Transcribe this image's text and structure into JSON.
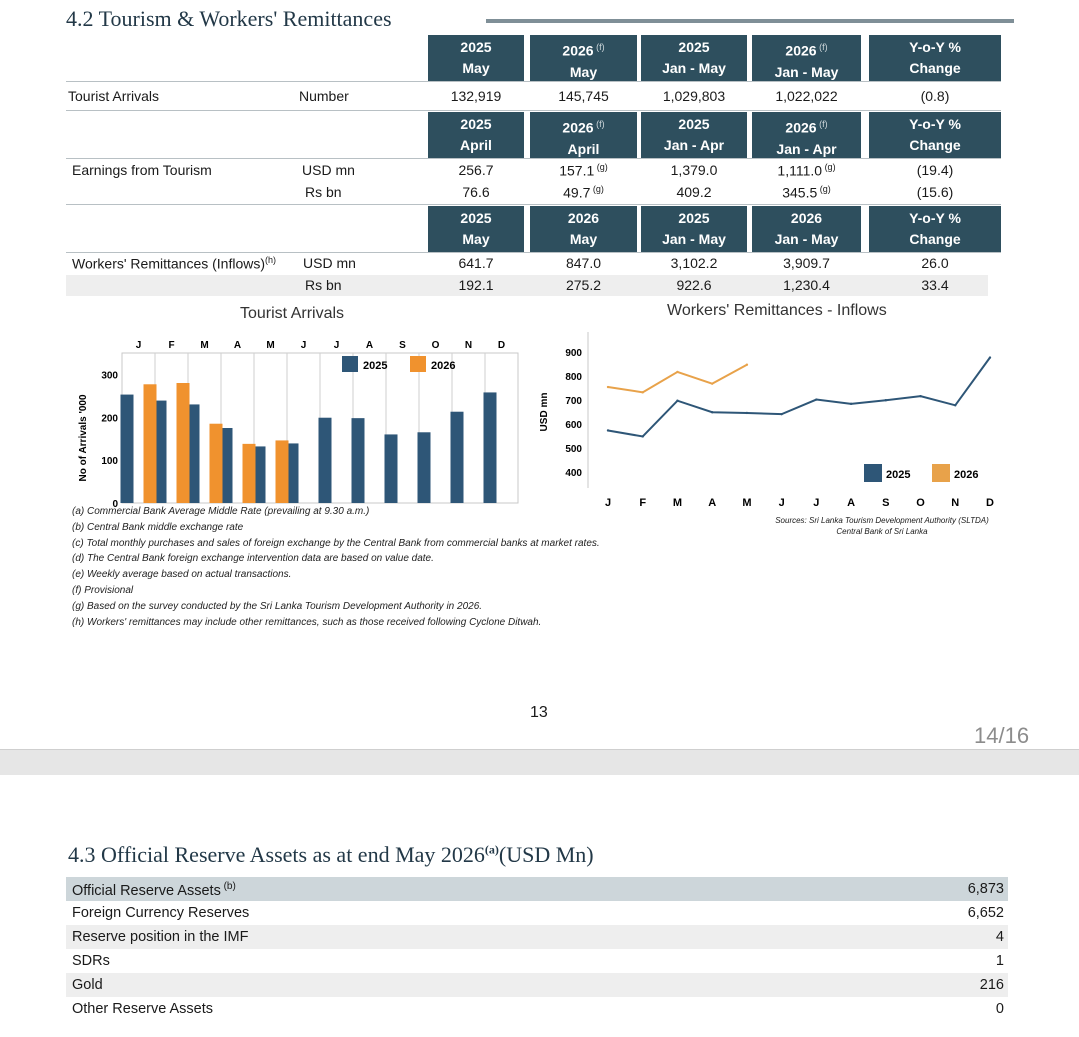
{
  "section_42": {
    "title": "4.2 Tourism & Workers' Remittances",
    "tourist_header": [
      {
        "l1": "2025",
        "sup": "",
        "l2": "May"
      },
      {
        "l1": "2026",
        "sup": "(f)",
        "l2": "May"
      },
      {
        "l1": "2025",
        "sup": "",
        "l2": "Jan - May"
      },
      {
        "l1": "2026",
        "sup": "(f)",
        "l2": "Jan - May"
      },
      {
        "l1": "Y-o-Y %",
        "sup": "",
        "l2": "Change"
      }
    ],
    "tourist_row": {
      "label": "Tourist Arrivals",
      "unit": "Number",
      "values": [
        "132,919",
        "145,745",
        "1,029,803",
        "1,022,022",
        "(0.8)"
      ]
    },
    "earnings_header": [
      {
        "l1": "2025",
        "sup": "",
        "l2": "April"
      },
      {
        "l1": "2026",
        "sup": "(f)",
        "l2": "April"
      },
      {
        "l1": "2025",
        "sup": "",
        "l2": "Jan - Apr"
      },
      {
        "l1": "2026",
        "sup": "(f)",
        "l2": "Jan - Apr"
      },
      {
        "l1": "Y-o-Y %",
        "sup": "",
        "l2": "Change"
      }
    ],
    "earnings_rows": [
      {
        "label": "Earnings from Tourism",
        "unit": "USD mn",
        "values": [
          "256.7",
          "157.1",
          "1,379.0",
          "1,111.0",
          "(19.4)"
        ],
        "sups": [
          "",
          "(g)",
          "",
          "(g)",
          ""
        ]
      },
      {
        "label": "",
        "unit": "Rs bn",
        "values": [
          "76.6",
          "49.7",
          "409.2",
          "345.5",
          "(15.6)"
        ],
        "sups": [
          "",
          "(g)",
          "",
          "(g)",
          ""
        ]
      }
    ],
    "remit_header": [
      {
        "l1": "2025",
        "sup": "",
        "l2": "May"
      },
      {
        "l1": "2026",
        "sup": "",
        "l2": "May"
      },
      {
        "l1": "2025",
        "sup": "",
        "l2": "Jan - May"
      },
      {
        "l1": "2026",
        "sup": "",
        "l2": "Jan - May"
      },
      {
        "l1": "Y-o-Y %",
        "sup": "",
        "l2": "Change"
      }
    ],
    "remit_rows": [
      {
        "label": "Workers' Remittances (Inflows)",
        "label_sup": "(h)",
        "unit": "USD mn",
        "values": [
          "641.7",
          "847.0",
          "3,102.2",
          "3,909.7",
          "26.0"
        ]
      },
      {
        "label": "",
        "label_sup": "",
        "unit": "Rs bn",
        "values": [
          "192.1",
          "275.2",
          "922.6",
          "1,230.4",
          "33.4"
        ]
      }
    ]
  },
  "chart_data": [
    {
      "type": "bar",
      "title": "Tourist Arrivals",
      "ylabel": "No of Arrivals '000",
      "ylim": [
        0,
        350
      ],
      "yticks": [
        "0",
        "100",
        "200",
        "300"
      ],
      "categories": [
        "J",
        "F",
        "M",
        "A",
        "M",
        "J",
        "J",
        "A",
        "S",
        "O",
        "N",
        "D"
      ],
      "series": [
        {
          "name": "2025",
          "color": "#2e5677",
          "values": [
            253,
            239,
            230,
            175,
            132,
            139,
            199,
            198,
            160,
            165,
            213,
            258
          ]
        },
        {
          "name": "2026",
          "color": "#f0922e",
          "values": [
            277,
            280,
            185,
            138,
            146,
            null,
            null,
            null,
            null,
            null,
            null,
            null
          ]
        }
      ],
      "legend": "top-right"
    },
    {
      "type": "line",
      "title": "Workers' Remittances  - Inflows",
      "ylabel": "USD mn",
      "ylim": [
        400,
        900
      ],
      "yticks": [
        "400",
        "500",
        "600",
        "700",
        "800",
        "900"
      ],
      "categories": [
        "J",
        "F",
        "M",
        "A",
        "M",
        "J",
        "J",
        "A",
        "S",
        "O",
        "N",
        "D"
      ],
      "series": [
        {
          "name": "2025",
          "color": "#2e5677",
          "values": [
            573,
            548,
            697,
            649,
            646,
            641,
            702,
            684,
            699,
            716,
            678,
            877
          ]
        },
        {
          "name": "2026",
          "color": "#e8a24a",
          "values": [
            754,
            732,
            817,
            768,
            847,
            null,
            null,
            null,
            null,
            null,
            null,
            null
          ]
        }
      ],
      "legend": "bottom-right"
    }
  ],
  "sources": [
    "Sources: Sri Lanka Tourism Development Authority (SLTDA)",
    "Central Bank of Sri Lanka"
  ],
  "footnotes": [
    "(a) Commercial Bank Average Middle Rate (prevailing at 9.30 a.m.)",
    "(b) Central Bank middle exchange rate",
    "(c) Total monthly purchases and sales of foreign exchange by the Central Bank from commercial banks at market rates.",
    "(d) The Central Bank foreign exchange intervention data are based on value date.",
    "(e) Weekly average based on actual transactions.",
    "(f) Provisional",
    "(g) Based on the survey conducted by the Sri Lanka Tourism Development Authority in 2026.",
    "(h) Workers' remittances may include other remittances, such as those received following Cyclone Ditwah."
  ],
  "page_number": "13",
  "page_indicator": "14/16",
  "section_43": {
    "title_main": "4.3 Official Reserve Assets as at end May 2026",
    "title_sup": "(a)",
    "title_unit": "(USD Mn)",
    "rows": [
      {
        "label": "Official Reserve Assets",
        "sup": "(b)",
        "value": "6,873",
        "shade": "header"
      },
      {
        "label": "Foreign Currency Reserves",
        "sup": "",
        "value": "6,652",
        "shade": "none"
      },
      {
        "label": "Reserve position in the IMF",
        "sup": "",
        "value": "4",
        "shade": "light"
      },
      {
        "label": "SDRs",
        "sup": "",
        "value": "1",
        "shade": "none"
      },
      {
        "label": "Gold",
        "sup": "",
        "value": "216",
        "shade": "light"
      },
      {
        "label": "Other Reserve Assets",
        "sup": "",
        "value": "0",
        "shade": "none"
      }
    ]
  }
}
